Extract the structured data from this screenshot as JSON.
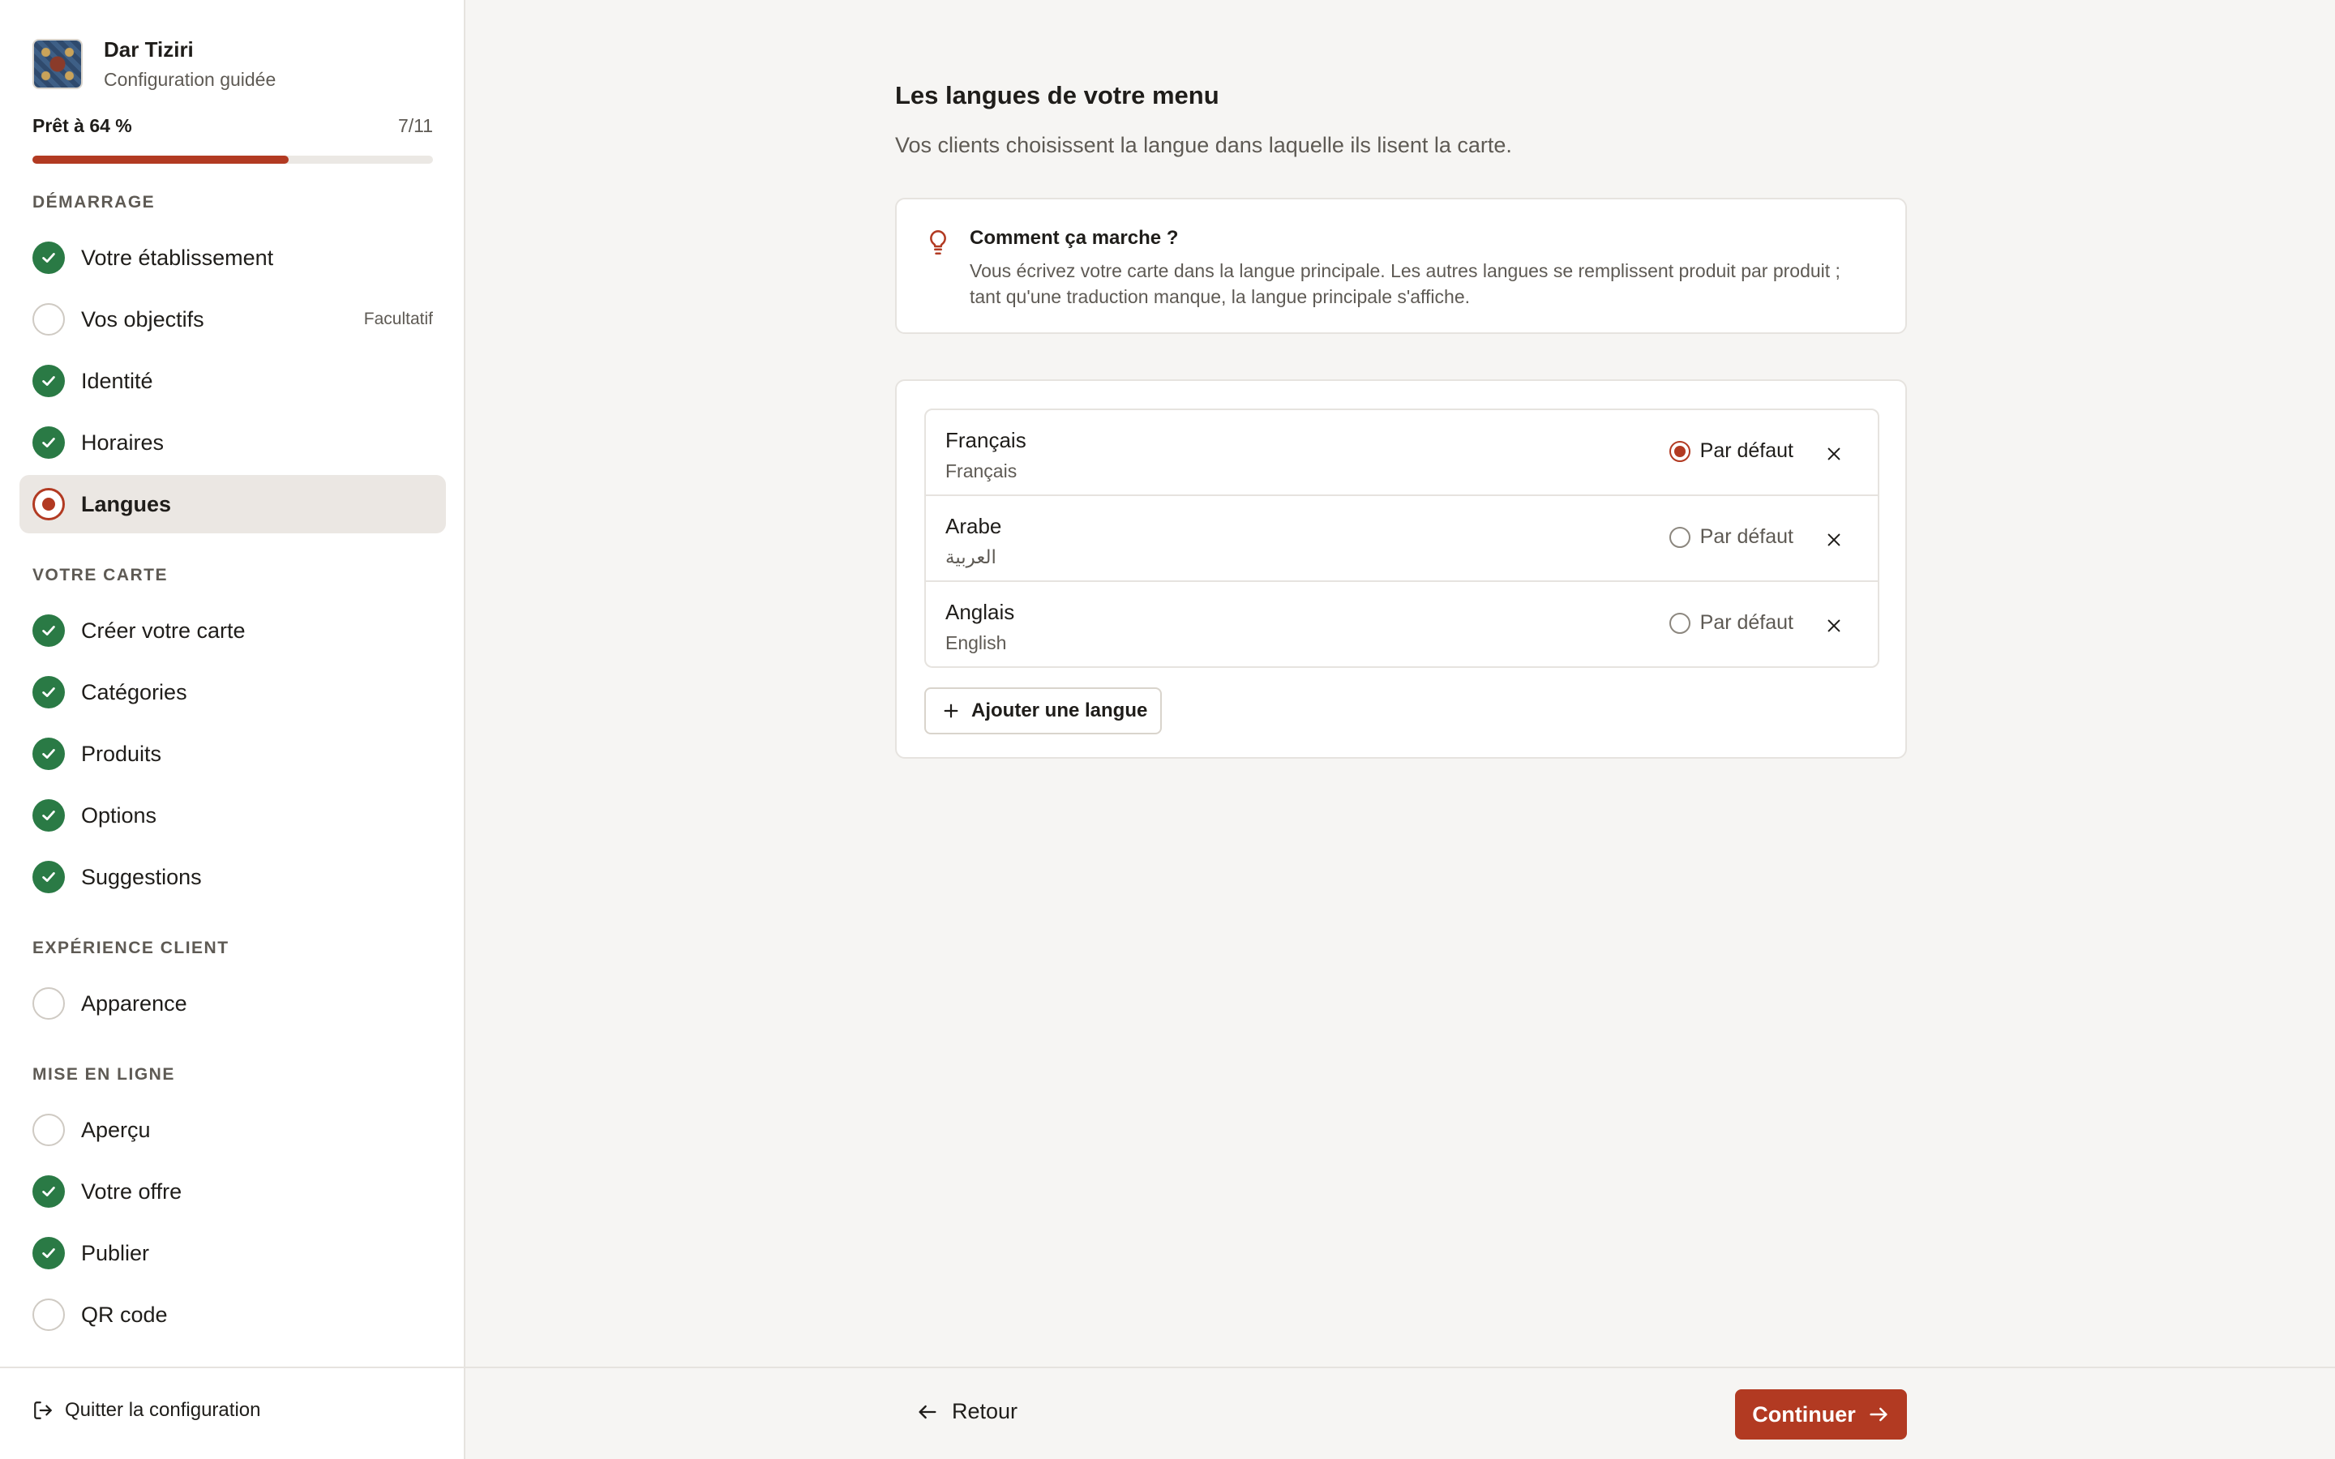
{
  "brand": {
    "name": "Dar Tiziri",
    "subtitle": "Configuration guidée"
  },
  "progress": {
    "label": "Prêt à 64 %",
    "count": "7/11",
    "fraction": 0.64
  },
  "sections": [
    {
      "title": "Démarrage"
    },
    {
      "title": "Votre carte"
    },
    {
      "title": "Expérience client"
    },
    {
      "title": "Mise en ligne"
    }
  ],
  "nav": [
    {
      "label": "Votre établissement",
      "status": "done"
    },
    {
      "label": "Vos objectifs",
      "status": "todo",
      "optional": "Facultatif"
    },
    {
      "label": "Identité",
      "status": "done"
    },
    {
      "label": "Horaires",
      "status": "done"
    },
    {
      "label": "Langues",
      "status": "current"
    },
    {
      "label": "Créer votre carte",
      "status": "done"
    },
    {
      "label": "Catégories",
      "status": "done"
    },
    {
      "label": "Produits",
      "status": "done"
    },
    {
      "label": "Options",
      "status": "done"
    },
    {
      "label": "Suggestions",
      "status": "done"
    },
    {
      "label": "Apparence",
      "status": "todo"
    },
    {
      "label": "Aperçu",
      "status": "todo"
    },
    {
      "label": "Votre offre",
      "status": "done"
    },
    {
      "label": "Publier",
      "status": "done"
    },
    {
      "label": "QR code",
      "status": "todo"
    }
  ],
  "quit_label": "Quitter la configuration",
  "main": {
    "title": "Les langues de votre menu",
    "subtitle": "Vos clients choisissent la langue dans laquelle ils lisent la carte.",
    "info": {
      "title": "Comment ça marche ?",
      "text": "Vous écrivez votre carte dans la langue principale. Les autres langues se remplissent produit par produit ; tant qu'une traduction manque, la langue principale s'affiche."
    },
    "languages": [
      {
        "name": "Français",
        "native": "Français",
        "default_label": "Par défaut",
        "is_default": true
      },
      {
        "name": "Arabe",
        "native": "العربية",
        "default_label": "Par défaut",
        "is_default": false
      },
      {
        "name": "Anglais",
        "native": "English",
        "default_label": "Par défaut",
        "is_default": false
      }
    ],
    "add_language_label": "Ajouter une langue"
  },
  "footer": {
    "back_label": "Retour",
    "next_label": "Continuer"
  },
  "colors": {
    "accent": "#b23a22",
    "done": "#2a7a45",
    "background": "#f6f5f3"
  }
}
